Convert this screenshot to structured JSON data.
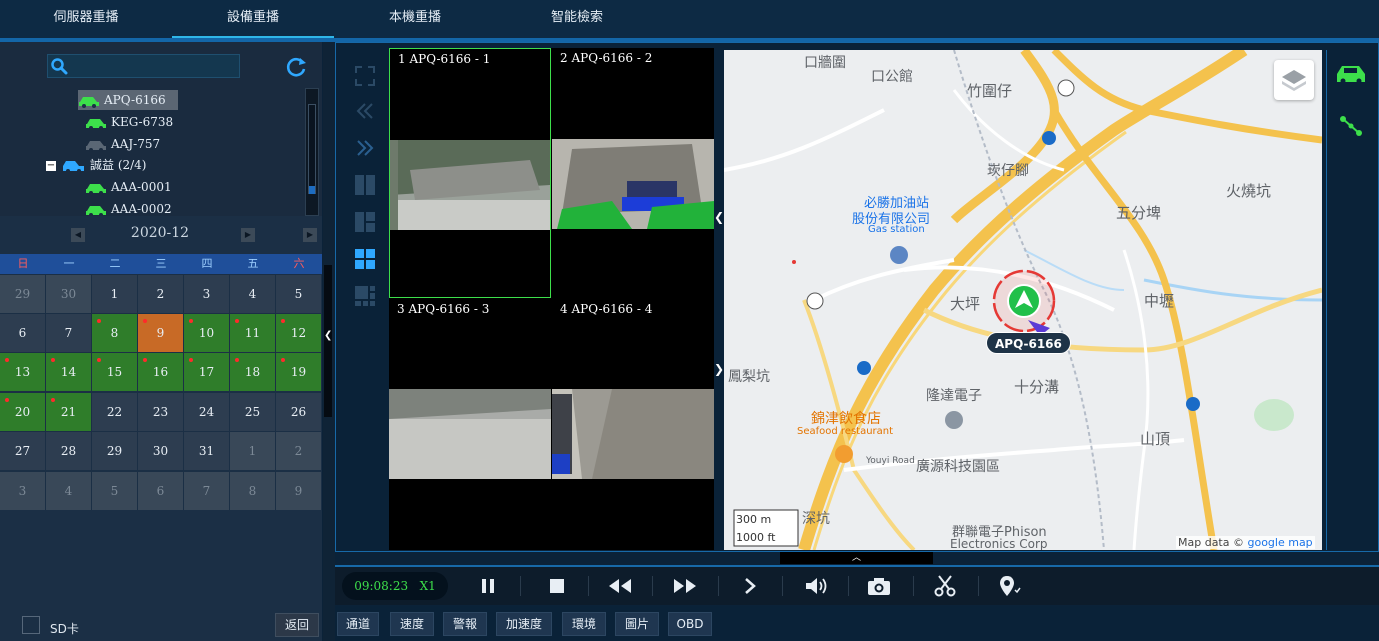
{
  "tabs": [
    {
      "label": "伺服器重播",
      "active": false
    },
    {
      "label": "設備重播",
      "active": true
    },
    {
      "label": "本機重播",
      "active": false
    },
    {
      "label": "智能檢索",
      "active": false
    }
  ],
  "tree": {
    "items": [
      {
        "label": "APQ-6166",
        "status": "online",
        "selected": true
      },
      {
        "label": "KEG-6738",
        "status": "online"
      },
      {
        "label": "AAJ-757",
        "status": "offline"
      },
      {
        "label": "誠益 (2/4)",
        "group": true
      },
      {
        "label": "AAA-0001",
        "status": "online"
      },
      {
        "label": "AAA-0002",
        "status": "online"
      }
    ]
  },
  "calendar": {
    "month_label": "2020-12",
    "weekdays": [
      "日",
      "一",
      "二",
      "三",
      "四",
      "五",
      "六"
    ],
    "days": [
      [
        "29",
        "30",
        "1",
        "2",
        "3",
        "4",
        "5"
      ],
      [
        "6",
        "7",
        "8",
        "9",
        "10",
        "11",
        "12"
      ],
      [
        "13",
        "14",
        "15",
        "16",
        "17",
        "18",
        "19"
      ],
      [
        "20",
        "21",
        "22",
        "23",
        "24",
        "25",
        "26"
      ],
      [
        "27",
        "28",
        "29",
        "30",
        "31",
        "1",
        "2"
      ],
      [
        "3",
        "4",
        "5",
        "6",
        "7",
        "8",
        "9"
      ]
    ],
    "cell_kinds": [
      [
        "other",
        "other",
        "norm",
        "norm",
        "norm",
        "norm",
        "norm"
      ],
      [
        "norm",
        "norm",
        "rec",
        "today",
        "rec",
        "rec",
        "rec"
      ],
      [
        "rec",
        "rec",
        "rec",
        "rec",
        "rec",
        "rec",
        "rec"
      ],
      [
        "rec",
        "rec",
        "norm",
        "norm",
        "norm",
        "norm",
        "norm"
      ],
      [
        "norm",
        "norm",
        "norm",
        "norm",
        "norm",
        "other",
        "other"
      ],
      [
        "other",
        "other",
        "other",
        "other",
        "other",
        "other",
        "other"
      ]
    ],
    "cell_dots": [
      [
        false,
        false,
        false,
        false,
        false,
        false,
        false
      ],
      [
        false,
        false,
        true,
        true,
        true,
        true,
        true
      ],
      [
        true,
        true,
        true,
        true,
        true,
        true,
        true
      ],
      [
        true,
        true,
        false,
        false,
        false,
        false,
        false
      ],
      [
        false,
        false,
        false,
        false,
        false,
        false,
        false
      ],
      [
        false,
        false,
        false,
        false,
        false,
        false,
        false
      ]
    ]
  },
  "sd_label": "SD卡",
  "back_label": "返回",
  "videos": [
    {
      "label": "1 APQ-6166 - 1",
      "active": true
    },
    {
      "label": "2 APQ-6166 - 2",
      "active": false
    },
    {
      "label": "3 APQ-6166 - 3",
      "active": false
    },
    {
      "label": "4 APQ-6166 - 4",
      "active": false
    }
  ],
  "map": {
    "vehicle_label": "APQ-6166",
    "labels": {
      "l1": "口牆圍",
      "l2": "口公館",
      "l3": "竹圍仔",
      "l4": "崁仔腳",
      "l5": "必勝加油站",
      "l6": "股份有限公司",
      "l7": "Gas station",
      "l8": "五分埤",
      "l9": "火燒坑",
      "l10": "大坪",
      "l11": "中壢",
      "l12": "鳳梨坑",
      "l13": "隆達電子",
      "l14": "十分溝",
      "l15": "錦津飲食店",
      "l16": "Seafood restaurant",
      "l17": "Youyi Road",
      "l18": "廣源科技園區",
      "l19": "山頂",
      "l20": "群聯電子Phison",
      "l21": "Electronics Corp",
      "l22": "深坑"
    },
    "scale_m": "300 m",
    "scale_ft": "1000 ft",
    "attribution": "Map data ©",
    "attribution_brand": "google map"
  },
  "playback": {
    "time": "09:08:23",
    "speed": "X1"
  },
  "bottom_tabs": [
    "通道",
    "速度",
    "警報",
    "加速度",
    "環境",
    "圖片",
    "OBD"
  ],
  "colors": {
    "accent": "#1769a8",
    "record_green": "#2f7d2a",
    "today_orange": "#c86a26",
    "time_green": "#3ddf4b"
  }
}
